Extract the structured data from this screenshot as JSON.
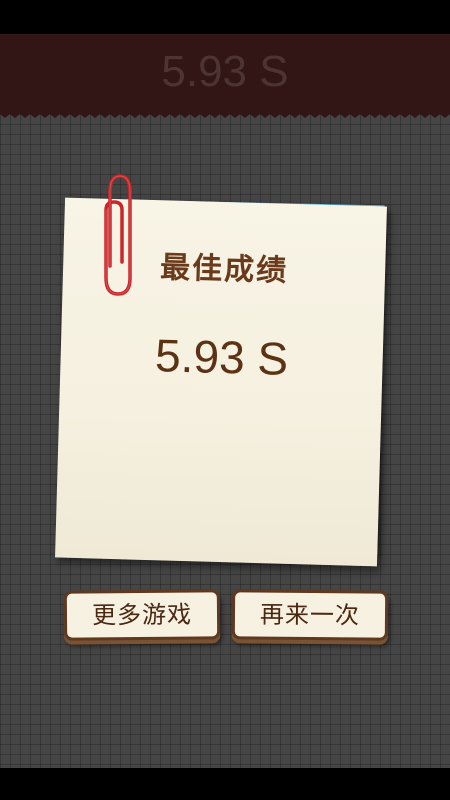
{
  "header": {
    "time_text": "5.93 S"
  },
  "result_card": {
    "title": "最佳成绩",
    "best_score": "5.93 S"
  },
  "buttons": {
    "more_games": "更多游戏",
    "play_again": "再来一次"
  },
  "colors": {
    "header_bg": "#321515",
    "board_bg": "#454545",
    "note_paper": "#f6f1e1",
    "note_back": "#5fb7da",
    "text_brown": "#5c3214",
    "paperclip": "#c8262a"
  }
}
